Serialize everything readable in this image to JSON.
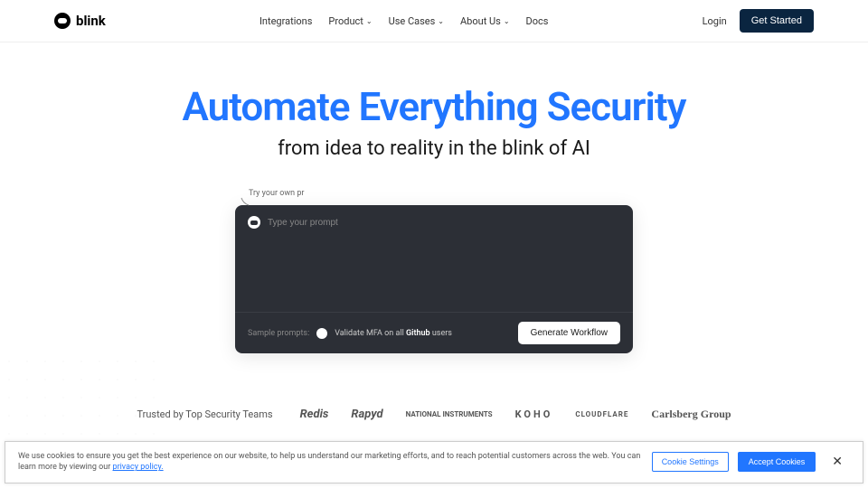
{
  "header": {
    "logo": "blink",
    "nav": {
      "integrations": "Integrations",
      "product": "Product",
      "usecases": "Use Cases",
      "aboutus": "About Us",
      "docs": "Docs"
    },
    "login": "Login",
    "getStarted": "Get Started"
  },
  "hero": {
    "title": "Automate Everything Security",
    "subtitle": "from idea to reality in the blink of AI"
  },
  "prompt": {
    "tryLabel": "Try your own pr",
    "placeholder": "Type your prompt",
    "sampleLabel": "Sample prompts:",
    "samplePrefix": "Validate MFA on all ",
    "sampleBold": "Github",
    "sampleSuffix": " users",
    "generateBtn": "Generate Workflow"
  },
  "trusted": {
    "label": "Trusted by Top Security Teams",
    "logos": {
      "redis": "Redis",
      "rapyd": "Rapyd",
      "ni": "NATIONAL INSTRUMENTS",
      "koho": "KOHO",
      "cloudflare": "CLOUDFLARE",
      "carlsberg": "Carlsberg Group"
    }
  },
  "cookie": {
    "text1": "We use cookies to ensure you get the best experience on our website, to help us understand our marketing efforts, and to reach potential customers across the web. You can learn more by viewing our ",
    "link": "privacy policy.",
    "settings": "Cookie Settings",
    "accept": "Accept Cookies"
  }
}
